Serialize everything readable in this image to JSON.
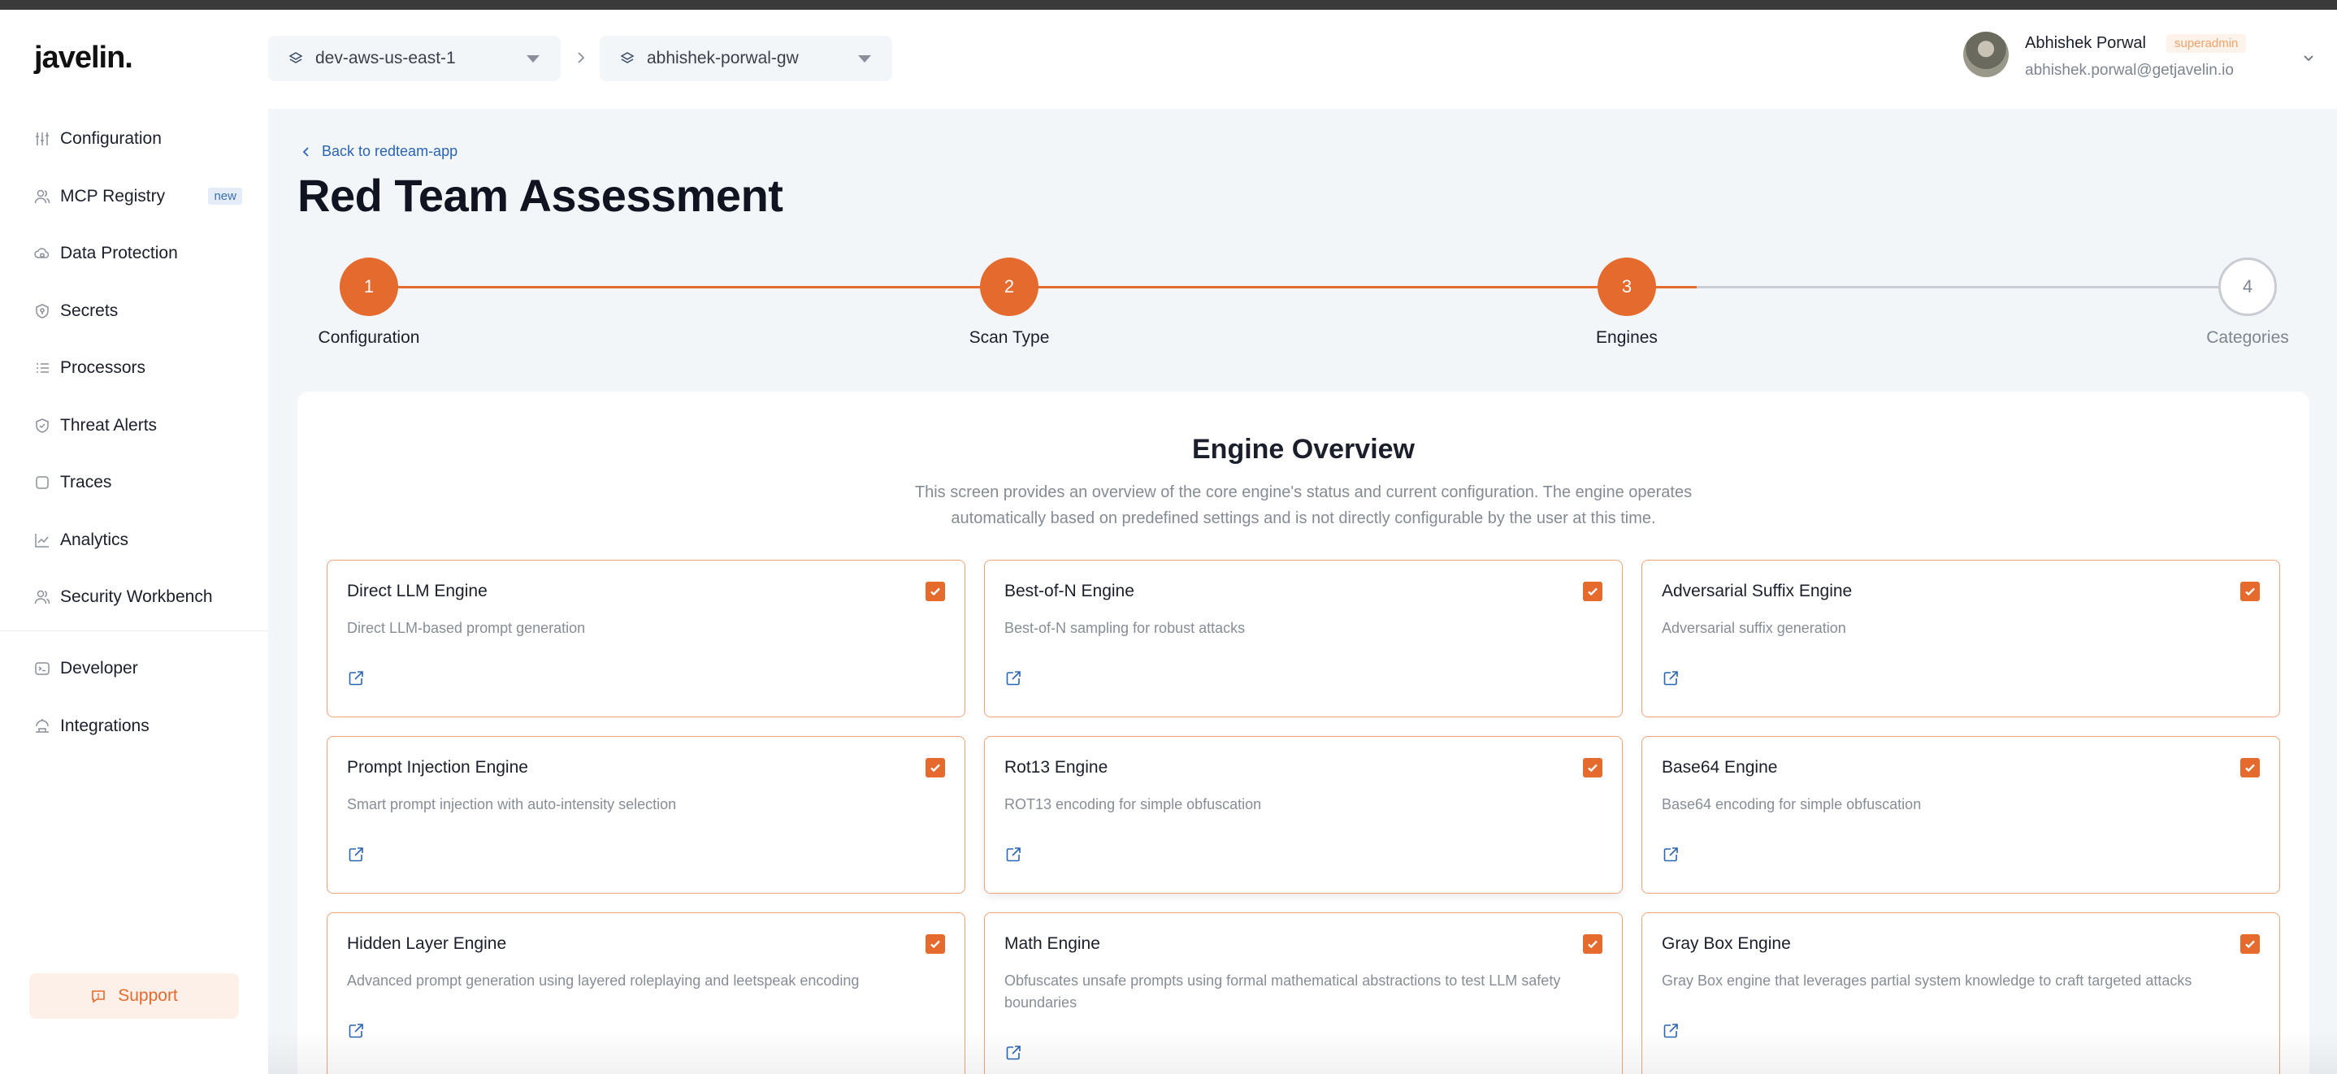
{
  "app": {
    "logo": "javelin."
  },
  "sidebar": {
    "items": [
      {
        "label": "Configuration",
        "icon": "sliders-icon"
      },
      {
        "label": "MCP Registry",
        "icon": "users-icon",
        "badge": "new"
      },
      {
        "label": "Data Protection",
        "icon": "cloud-lock-icon"
      },
      {
        "label": "Secrets",
        "icon": "shield-key-icon"
      },
      {
        "label": "Processors",
        "icon": "list-icon"
      },
      {
        "label": "Threat Alerts",
        "icon": "shield-check-icon"
      },
      {
        "label": "Traces",
        "icon": "square-icon"
      },
      {
        "label": "Analytics",
        "icon": "chart-line-icon"
      },
      {
        "label": "Security Workbench",
        "icon": "users-icon"
      }
    ],
    "secondary": [
      {
        "label": "Developer",
        "icon": "terminal-icon"
      },
      {
        "label": "Integrations",
        "icon": "plug-icon"
      }
    ],
    "support": "Support"
  },
  "header": {
    "env_selector": "dev-aws-us-east-1",
    "gateway_selector": "abhishek-porwal-gw",
    "user": {
      "name": "Abhishek Porwal",
      "role": "superadmin",
      "email": "abhishek.porwal@getjavelin.io"
    }
  },
  "page": {
    "back_link": "Back to redteam-app",
    "title": "Red Team Assessment"
  },
  "stepper": {
    "steps": [
      {
        "number": "1",
        "label": "Configuration",
        "status": "complete"
      },
      {
        "number": "2",
        "label": "Scan Type",
        "status": "complete"
      },
      {
        "number": "3",
        "label": "Engines",
        "status": "current"
      },
      {
        "number": "4",
        "label": "Categories",
        "status": "pending"
      }
    ]
  },
  "overview": {
    "title": "Engine Overview",
    "description": "This screen provides an overview of the core engine's status and current configuration. The engine operates automatically based on predefined settings and is not directly configurable by the user at this time."
  },
  "engines": [
    {
      "name": "Direct LLM Engine",
      "description": "Direct LLM-based prompt generation",
      "checked": true
    },
    {
      "name": "Best-of-N Engine",
      "description": "Best-of-N sampling for robust attacks",
      "checked": true
    },
    {
      "name": "Adversarial Suffix Engine",
      "description": "Adversarial suffix generation",
      "checked": true
    },
    {
      "name": "Prompt Injection Engine",
      "description": "Smart prompt injection with auto-intensity selection",
      "checked": true
    },
    {
      "name": "Rot13 Engine",
      "description": "ROT13 encoding for simple obfuscation",
      "checked": true
    },
    {
      "name": "Base64 Engine",
      "description": "Base64 encoding for simple obfuscation",
      "checked": true
    },
    {
      "name": "Hidden Layer Engine",
      "description": "Advanced prompt generation using layered roleplaying and leetspeak encoding",
      "checked": true
    },
    {
      "name": "Math Engine",
      "description": "Obfuscates unsafe prompts using formal mathematical abstractions to test LLM safety boundaries",
      "checked": true
    },
    {
      "name": "Gray Box Engine",
      "description": "Gray Box engine that leverages partial system knowledge to craft targeted attacks",
      "checked": true
    }
  ],
  "colors": {
    "accent": "#e46a2e",
    "link": "#2a64b4",
    "background": "#f3f6f9"
  }
}
